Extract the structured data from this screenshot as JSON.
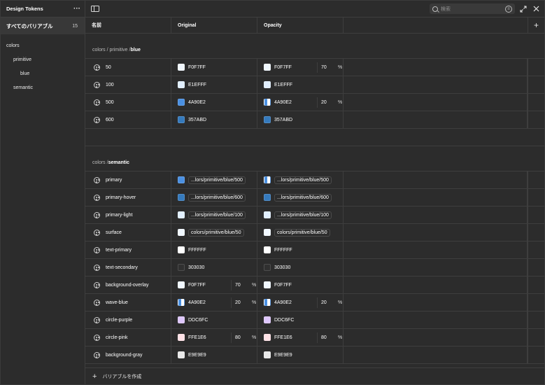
{
  "sidebar": {
    "title": "Design Tokens",
    "all": {
      "label": "すべてのバリアブル",
      "count": "15"
    },
    "tree": [
      {
        "label": "colors",
        "indent": 0
      },
      {
        "label": "primitive",
        "indent": 1
      },
      {
        "label": "blue",
        "indent": 2
      },
      {
        "label": "semantic",
        "indent": 1
      }
    ]
  },
  "toolbar": {
    "search_placeholder": "検索"
  },
  "columns": {
    "name": "名前",
    "original": "Original",
    "opacity": "Opacity"
  },
  "groups": [
    {
      "path": "colors / primitive / ",
      "leaf": "blue",
      "rows": [
        {
          "name": "50",
          "o": {
            "color": "#F0F7FF",
            "text": "F0F7FF",
            "alias": false,
            "op": ""
          },
          "p": {
            "color": "#F0F7FF",
            "text": "F0F7FF",
            "alias": false,
            "op": "70"
          }
        },
        {
          "name": "100",
          "o": {
            "color": "#E1EFFF",
            "text": "E1EFFF",
            "alias": false,
            "op": ""
          },
          "p": {
            "color": "#E1EFFF",
            "text": "E1EFFF",
            "alias": false,
            "op": ""
          }
        },
        {
          "name": "500",
          "o": {
            "color": "#4A90E2",
            "text": "4A90E2",
            "alias": false,
            "op": ""
          },
          "p": {
            "color": "half",
            "text": "4A90E2",
            "alias": false,
            "op": "20"
          }
        },
        {
          "name": "600",
          "o": {
            "color": "#357ABD",
            "text": "357ABD",
            "alias": false,
            "op": ""
          },
          "p": {
            "color": "#357ABD",
            "text": "357ABD",
            "alias": false,
            "op": ""
          }
        }
      ]
    },
    {
      "path": "colors / ",
      "leaf": "semantic",
      "rows": [
        {
          "name": "primary",
          "o": {
            "color": "#4A90E2",
            "text": "...lors/primitive/blue/500",
            "alias": true,
            "op": ""
          },
          "p": {
            "color": "half",
            "text": "...lors/primitive/blue/500",
            "alias": true,
            "op": ""
          }
        },
        {
          "name": "primary-hover",
          "o": {
            "color": "#357ABD",
            "text": "...lors/primitive/blue/600",
            "alias": true,
            "op": ""
          },
          "p": {
            "color": "#357ABD",
            "text": "...lors/primitive/blue/600",
            "alias": true,
            "op": ""
          }
        },
        {
          "name": "primary-light",
          "o": {
            "color": "#E1EFFF",
            "text": "...lors/primitive/blue/100",
            "alias": true,
            "op": ""
          },
          "p": {
            "color": "#E1EFFF",
            "text": "...lors/primitive/blue/100",
            "alias": true,
            "op": ""
          }
        },
        {
          "name": "surface",
          "o": {
            "color": "#F0F7FF",
            "text": "colors/primitive/blue/50",
            "alias": true,
            "op": ""
          },
          "p": {
            "color": "#F0F7FF",
            "text": "colors/primitive/blue/50",
            "alias": true,
            "op": ""
          }
        },
        {
          "name": "text-primary",
          "o": {
            "color": "#FFFFFF",
            "text": "FFFFFF",
            "alias": false,
            "op": ""
          },
          "p": {
            "color": "#FFFFFF",
            "text": "FFFFFF",
            "alias": false,
            "op": ""
          }
        },
        {
          "name": "text-secondary",
          "o": {
            "color": "#303030",
            "text": "303030",
            "alias": false,
            "op": ""
          },
          "p": {
            "color": "#303030",
            "text": "303030",
            "alias": false,
            "op": ""
          }
        },
        {
          "name": "background-overlay",
          "o": {
            "color": "#F0F7FF",
            "text": "F0F7FF",
            "alias": false,
            "op": "70"
          },
          "p": {
            "color": "#F0F7FF",
            "text": "F0F7FF",
            "alias": false,
            "op": ""
          }
        },
        {
          "name": "wave-blue",
          "o": {
            "color": "half",
            "text": "4A90E2",
            "alias": false,
            "op": "20"
          },
          "p": {
            "color": "half",
            "text": "4A90E2",
            "alias": false,
            "op": "20"
          }
        },
        {
          "name": "circle-purple",
          "o": {
            "color": "#DDC6FC",
            "text": "DDC6FC",
            "alias": false,
            "op": ""
          },
          "p": {
            "color": "#DDC6FC",
            "text": "DDC6FC",
            "alias": false,
            "op": ""
          }
        },
        {
          "name": "circle-pink",
          "o": {
            "color": "#FFE1E6",
            "text": "FFE1E6",
            "alias": false,
            "op": "80"
          },
          "p": {
            "color": "#FFE1E6",
            "text": "FFE1E6",
            "alias": false,
            "op": "80"
          }
        },
        {
          "name": "background-gray",
          "o": {
            "color": "#E9E9E9",
            "text": "E9E9E9",
            "alias": false,
            "op": ""
          },
          "p": {
            "color": "#E9E9E9",
            "text": "E9E9E9",
            "alias": false,
            "op": ""
          }
        }
      ]
    }
  ],
  "percent_sign": "%",
  "footer": {
    "create_label": "バリアブルを作成"
  }
}
